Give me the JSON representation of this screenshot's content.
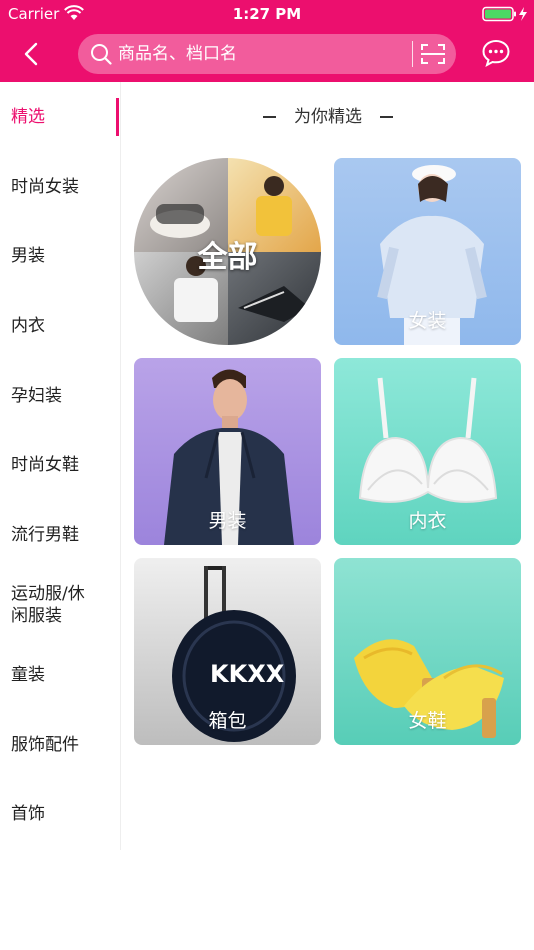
{
  "status_bar": {
    "carrier": "Carrier",
    "time": "1:27 PM"
  },
  "search": {
    "placeholder": "商品名、档口名"
  },
  "sidebar": {
    "items": [
      {
        "label": "精选",
        "active": true
      },
      {
        "label": "时尚女装"
      },
      {
        "label": "男装"
      },
      {
        "label": "内衣"
      },
      {
        "label": "孕妇装"
      },
      {
        "label": "时尚女鞋"
      },
      {
        "label": "流行男鞋"
      },
      {
        "label": "运动服/休闲服装"
      },
      {
        "label": "童装"
      },
      {
        "label": "服饰配件"
      },
      {
        "label": "首饰"
      }
    ]
  },
  "section": {
    "title": "为你精选"
  },
  "tiles": [
    {
      "label": "全部"
    },
    {
      "label": "女装"
    },
    {
      "label": "男装"
    },
    {
      "label": "内衣"
    },
    {
      "label": "箱包"
    },
    {
      "label": "女鞋"
    }
  ],
  "colors": {
    "brand": "#ec0f6e"
  },
  "bag_print": "KKXX"
}
